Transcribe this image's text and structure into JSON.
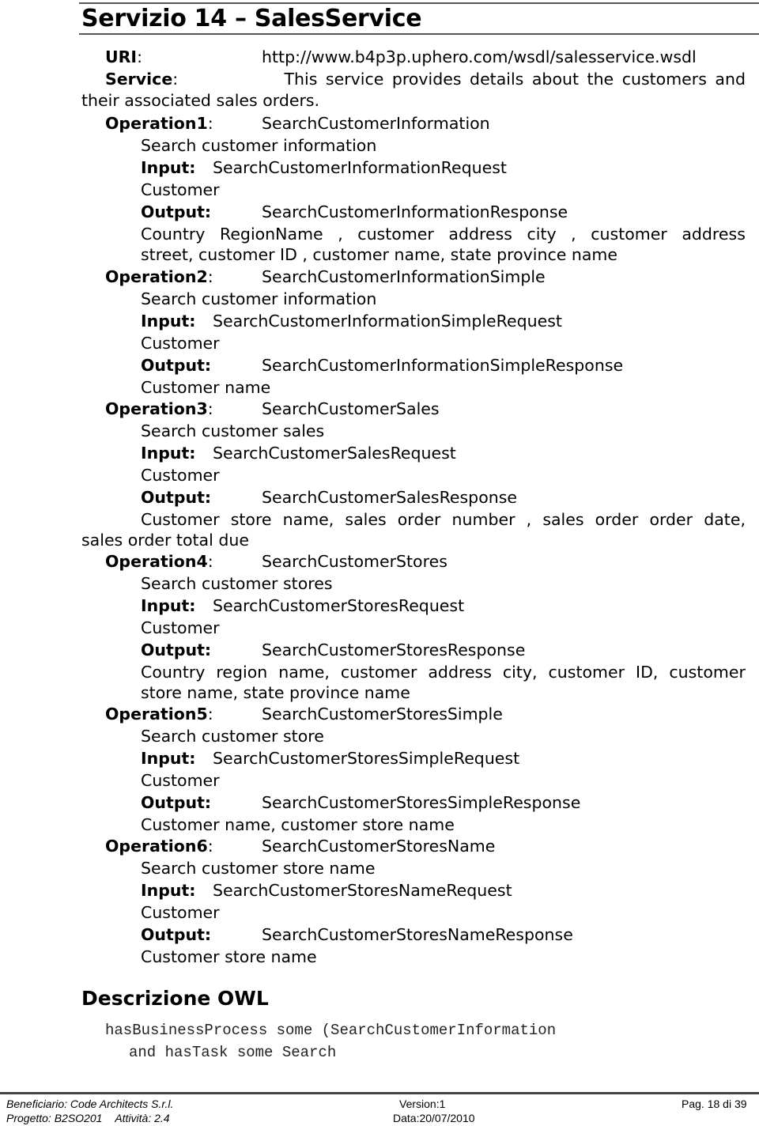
{
  "header": {
    "title": "Servizio 14 – SalesService"
  },
  "uri": {
    "label": "URI",
    "value": "http://www.b4p3p.uphero.com/wsdl/salesservice.wsdl"
  },
  "service": {
    "label": "Service",
    "line1": "This service provides details about the customers and",
    "line2": "their associated sales orders."
  },
  "operations": [
    {
      "label": "Operation1",
      "name": "SearchCustomerInformation",
      "description": "Search customer information",
      "input_label": "Input:",
      "input": "SearchCustomerInformationRequest",
      "input_param": "Customer",
      "output_label": "Output:",
      "output": "SearchCustomerInformationResponse",
      "output_fields_line1": [
        "Country",
        "RegionName",
        ",",
        "customer",
        "address",
        "city",
        ",",
        "customer",
        "address"
      ],
      "output_fields_line2": "street, customer ID , customer name, state province name"
    },
    {
      "label": "Operation2",
      "name": "SearchCustomerInformationSimple",
      "description": "Search customer information",
      "input_label": "Input:",
      "input": "SearchCustomerInformationSimpleRequest",
      "input_param": "Customer",
      "output_label": "Output:",
      "output": "SearchCustomerInformationSimpleResponse",
      "output_fields_line1": "Customer name"
    },
    {
      "label": "Operation3",
      "name": "SearchCustomerSales",
      "description": "Search customer sales",
      "input_label": "Input:",
      "input": "SearchCustomerSalesRequest",
      "input_param": "Customer",
      "output_label": "Output:",
      "output": "SearchCustomerSalesResponse",
      "output_fields_line1": [
        "Customer",
        "store",
        "name,",
        "sales",
        "order",
        "number",
        ",",
        "sales",
        "order",
        "order",
        "date,"
      ],
      "output_fields_line2": "sales order total due"
    },
    {
      "label": "Operation4",
      "name": "SearchCustomerStores",
      "description": "Search customer stores",
      "input_label": "Input:",
      "input": "SearchCustomerStoresRequest",
      "input_param": "Customer",
      "output_label": "Output:",
      "output": "SearchCustomerStoresResponse",
      "output_fields_line1": [
        "Country",
        "region",
        "name,",
        "customer",
        "address",
        "city,",
        "customer",
        "ID,",
        "customer"
      ],
      "output_fields_line2": "store name, state province name"
    },
    {
      "label": "Operation5",
      "name": "SearchCustomerStoresSimple",
      "description": "Search customer store",
      "input_label": "Input:",
      "input": "SearchCustomerStoresSimpleRequest",
      "input_param": "Customer",
      "output_label": "Output:",
      "output": "SearchCustomerStoresSimpleResponse",
      "output_fields_line1": "Customer name, customer store name"
    },
    {
      "label": "Operation6",
      "name": "SearchCustomerStoresName",
      "description": "Search customer store name",
      "input_label": "Input:",
      "input": "SearchCustomerStoresNameRequest",
      "input_param": "Customer",
      "output_label": "Output:",
      "output": "SearchCustomerStoresNameResponse",
      "output_fields_line1": "Customer store name"
    }
  ],
  "owl": {
    "title": "Descrizione OWL",
    "line1": "hasBusinessProcess some (SearchCustomerInformation",
    "line2": "and hasTask some Search"
  },
  "footer": {
    "beneficiario": "Beneficiario: Code Architects S.r.l.",
    "progetto": "Progetto: B2SO201",
    "attivita": "Attività: 2.4",
    "version": "Version:1",
    "data": "Data:20/07/2010",
    "page": "Pag. 18 di 39"
  }
}
